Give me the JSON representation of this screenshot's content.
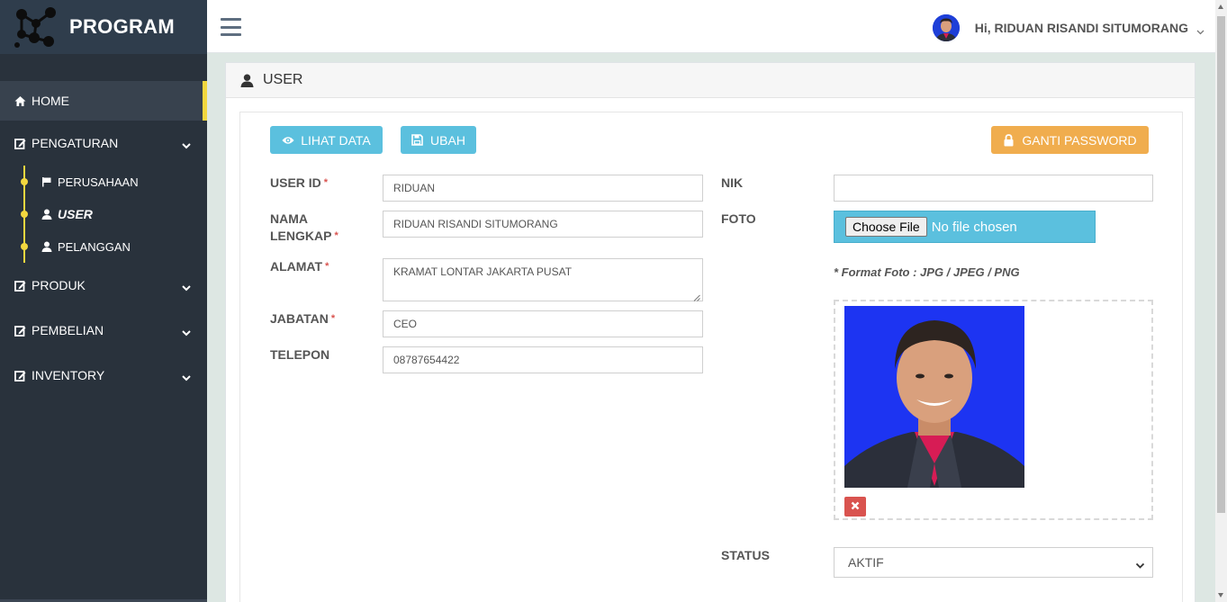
{
  "app": {
    "brand": "PROGRAM"
  },
  "header": {
    "greeting": "Hi, RIDUAN RISANDI SITUMORANG"
  },
  "sidebar": {
    "items": [
      {
        "label": "HOME",
        "icon": "home-icon"
      },
      {
        "label": "PENGATURAN",
        "icon": "edit-icon",
        "children": [
          {
            "label": "PERUSAHAAN",
            "icon": "flag-icon"
          },
          {
            "label": "USER",
            "icon": "user-icon"
          },
          {
            "label": "PELANGGAN",
            "icon": "user-icon"
          }
        ]
      },
      {
        "label": "PRODUK",
        "icon": "edit-icon"
      },
      {
        "label": "PEMBELIAN",
        "icon": "edit-icon"
      },
      {
        "label": "INVENTORY",
        "icon": "edit-icon"
      }
    ]
  },
  "page": {
    "title": "USER"
  },
  "toolbar": {
    "view_label": "LIHAT DATA",
    "save_label": "UBAH",
    "password_label": "GANTI PASSWORD"
  },
  "form": {
    "required_mark": "*",
    "user_id": {
      "label": "USER ID",
      "value": "RIDUAN"
    },
    "nama_lengkap": {
      "label_line1": "NAMA",
      "label_line2": "LENGKAP",
      "value": "RIDUAN RISANDI SITUMORANG"
    },
    "alamat": {
      "label": "ALAMAT",
      "value": "KRAMAT LONTAR JAKARTA PUSAT"
    },
    "jabatan": {
      "label": "JABATAN",
      "value": "CEO"
    },
    "telepon": {
      "label": "TELEPON",
      "value": "08787654422"
    },
    "nik": {
      "label": "NIK",
      "value": ""
    },
    "foto": {
      "label": "FOTO",
      "button": "Choose File",
      "status": "No file chosen",
      "note": "* Format Foto : JPG / JPEG / PNG"
    },
    "status": {
      "label": "STATUS",
      "value": "AKTIF"
    }
  },
  "colors": {
    "sidebar_bg": "#29323c",
    "accent_yellow": "#f3d73f",
    "info": "#5bc0de",
    "warning": "#f0ad4e",
    "danger": "#d9534f"
  }
}
